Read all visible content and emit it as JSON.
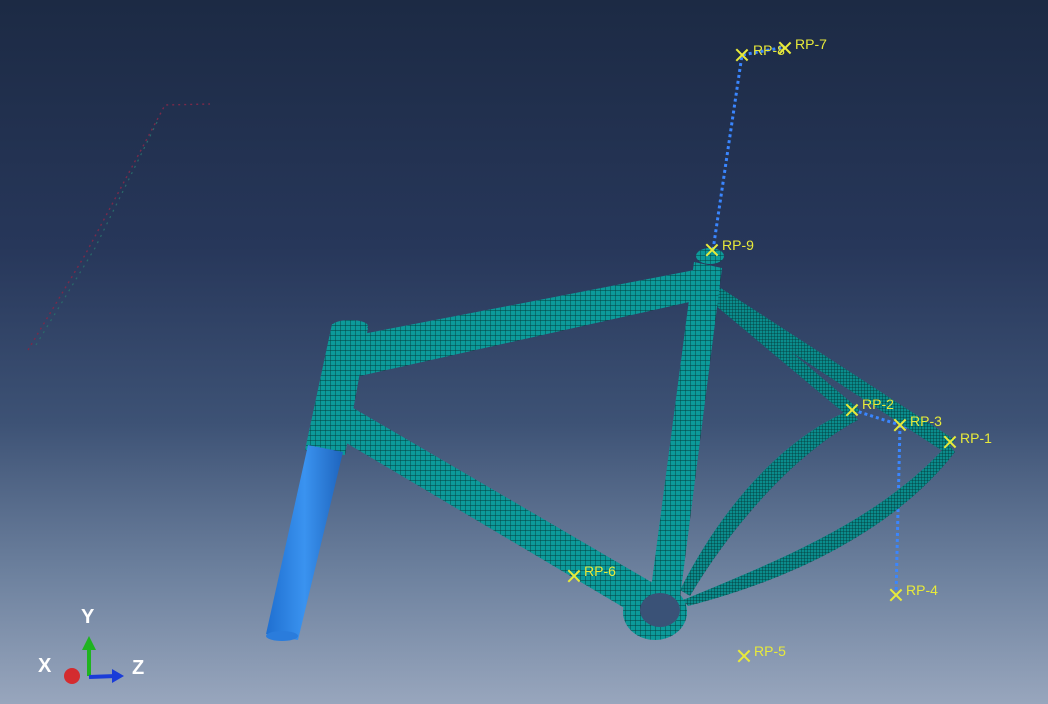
{
  "reference_points": [
    {
      "name": "RP-8",
      "label": "RP-8"
    },
    {
      "name": "RP-7",
      "label": "RP-7"
    },
    {
      "name": "RP-9",
      "label": "RP-9"
    },
    {
      "name": "RP-2",
      "label": "RP-2"
    },
    {
      "name": "RP-3",
      "label": "RP-3"
    },
    {
      "name": "RP-1",
      "label": "RP-1"
    },
    {
      "name": "RP-6",
      "label": "RP-6"
    },
    {
      "name": "RP-4",
      "label": "RP-4"
    },
    {
      "name": "RP-5",
      "label": "RP-5"
    }
  ],
  "triad": {
    "x_label": "X",
    "y_label": "Y",
    "z_label": "Z",
    "x_color": "#e01818",
    "y_color": "#1fb41f",
    "z_color": "#1a3cd8"
  },
  "colors": {
    "mesh": "#0c9a9a",
    "mesh_lines": "#053c3c",
    "rigid_part": "#2f86e6",
    "connector": "#3a86ff",
    "rp_marker": "#e8ea3a"
  }
}
